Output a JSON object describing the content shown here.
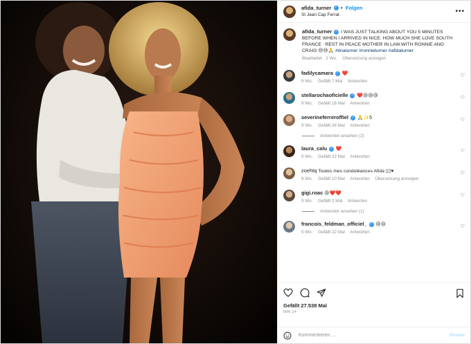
{
  "post": {
    "username": "afida_turner",
    "follow_label": "Folgen",
    "location": "St Jean Cap Ferrat",
    "caption_text": "I WAS JUST TALKING ABOUT YOU 5 MINUTES BEFORE WHEN I ARRIVED IN NICE. HOW MUCH SHE LOVE SOUTH FRANCE : REST IN PEACE MOTHER IN LAW.WITH RONNIE ANG CRAIG 😢😢🙏",
    "caption_tags": "#tinaturner #ronnieturner #afidaturner",
    "caption_meta_edited": "Bearbeitet · 2 Wo.",
    "caption_meta_translate": "Übersetzung anzeigen",
    "likes": "Gefällt 27.538 Mal",
    "date": "MAI 24",
    "comment_placeholder": "Kommentieren ...",
    "post_button": "Posten"
  },
  "comments": [
    {
      "username": "fadilycamara",
      "text": "❤️",
      "time": "9 Wo.",
      "likes": "Gefällt 7 Mal",
      "reply": "Antworten",
      "translate": ""
    },
    {
      "username": "stellarochaoficielle",
      "text": "❤️😢😢😢",
      "time": "9 Wo.",
      "likes": "Gefällt 18 Mal",
      "reply": "Antworten",
      "translate": ""
    },
    {
      "username": "severineferreroffiel",
      "text": "🙏✨5",
      "time": "9 Wo.",
      "likes": "Gefällt 34 Mal",
      "reply": "Antworten",
      "translate": ""
    },
    {
      "username": "laura_calu",
      "text": "❤️",
      "time": "9 Wo.",
      "likes": "Gefällt 22 Mal",
      "reply": "Antworten",
      "translate": ""
    },
    {
      "username": "zoehtq",
      "text": "Toutes mes condoléances Afida ▯▯♥",
      "time": "8 Wo.",
      "likes": "Gefällt 10 Mal",
      "reply": "Antworten",
      "translate": "Übersetzung anzeigen"
    },
    {
      "username": "gigi.roac",
      "text": "😢❤️❤️",
      "time": "9 Wo.",
      "likes": "Gefällt 3 Mal",
      "reply": "Antworten",
      "translate": ""
    },
    {
      "username": "francois_feldman_officiel_",
      "text": "😢😢",
      "time": "9 Wo.",
      "likes": "Gefällt 22 Mal",
      "reply": "Antworten",
      "translate": ""
    }
  ],
  "view_replies": [
    "Antworten ansehen (2)",
    "Antworten ansehen (1)"
  ],
  "icons": [
    "heart-icon",
    "comment-icon",
    "share-icon",
    "bookmark-icon",
    "more-options-icon",
    "smiley-icon"
  ],
  "colors": {
    "verified": "#3897f0",
    "link": "#00376b",
    "follow": "#0095f6",
    "dress": "#f4a77b"
  }
}
